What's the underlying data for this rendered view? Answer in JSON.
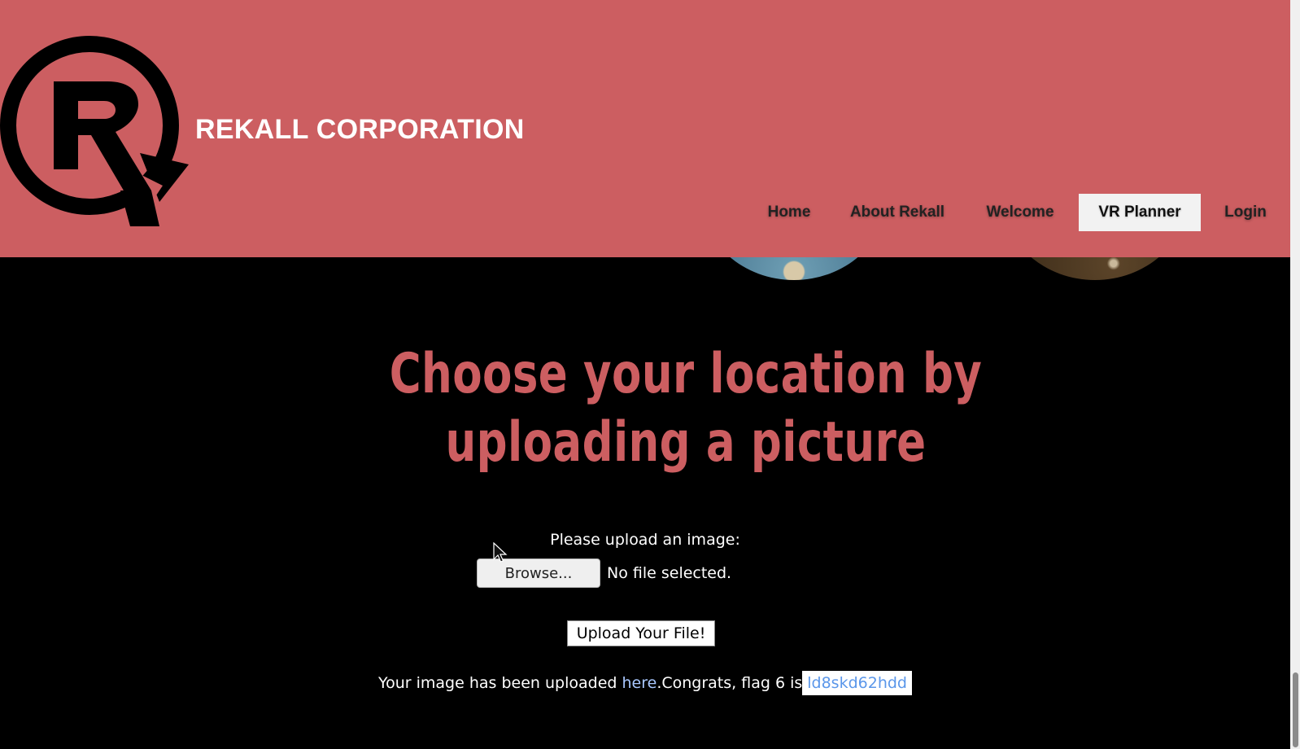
{
  "header": {
    "brand": "REKALL CORPORATION",
    "logo_icon": "rekall-r-logo-icon",
    "background_color": "#cc5e61"
  },
  "nav": {
    "items": [
      {
        "label": "Home",
        "active": false
      },
      {
        "label": "About Rekall",
        "active": false
      },
      {
        "label": "Welcome",
        "active": false
      },
      {
        "label": "VR Planner",
        "active": true
      },
      {
        "label": "Login",
        "active": false
      }
    ]
  },
  "main": {
    "title": "Choose your location by uploading a picture",
    "title_color": "#cc5e61",
    "upload": {
      "prompt": "Please upload an image:",
      "browse_label": "Browse...",
      "file_status": "No file selected.",
      "submit_label": "Upload Your File!"
    },
    "result": {
      "prefix": "Your image has been uploaded ",
      "link_text": "here",
      "message": ".Congrats, flag 6 is",
      "flag": "ld8skd62hdd",
      "link_color": "#5b97ea"
    }
  }
}
